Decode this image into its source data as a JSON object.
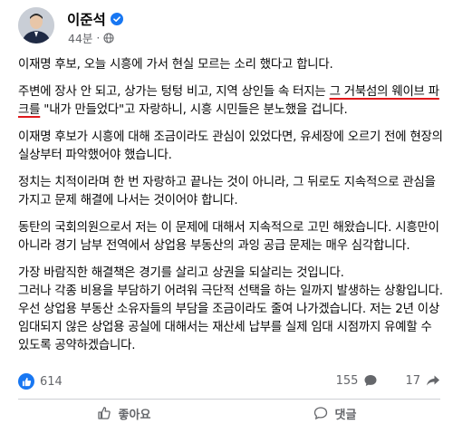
{
  "post": {
    "author": "이준석",
    "time": "44분",
    "dot": "·",
    "paragraphs": [
      {
        "before": "이재명 후보, 오늘 시흥에 가서 현실 모르는 소리 했다고 합니다.",
        "highlight": "",
        "after": ""
      },
      {
        "before": "주변에 장사 안 되고, 상가는 텅텅 비고, 지역 상인들 속 터지는 ",
        "highlight": "그 거북섬의 웨이브 파크를",
        "after": " \"내가 만들었다\"고 자랑하니, 시흥 시민들은 분노했을 겁니다."
      },
      {
        "before": "이재명 후보가 시흥에 대해 조금이라도 관심이 있었다면, 유세장에 오르기 전에 현장의 실상부터 파악했어야 했습니다.",
        "highlight": "",
        "after": ""
      },
      {
        "before": "정치는 치적이라며 한 번 자랑하고 끝나는 것이 아니라, 그 뒤로도 지속적으로 관심을 가지고 문제 해결에 나서는 것이어야 합니다.",
        "highlight": "",
        "after": ""
      },
      {
        "before": "동탄의 국회의원으로서 저는 이 문제에 대해서 지속적으로 고민 해왔습니다. 시흥만이 아니라 경기 남부 전역에서 상업용 부동산의 과잉 공급 문제는 매우 심각합니다.",
        "highlight": "",
        "after": ""
      },
      {
        "before": "가장 바람직한 해결책은 경기를 살리고 상권을 되살리는 것입니다.\n그러나 각종 비용을 부담하기 어려워 극단적 선택을 하는 일까지 발생하는 상황입니다. 우선 상업용 부동산 소유자들의 부담을 조금이라도 줄여 나가겠습니다. 저는 2년 이상 임대되지 않은 상업용 공실에 대해서는 재산세 납부를 실제 임대 시점까지 유예할 수 있도록 공약하겠습니다.",
        "highlight": "",
        "after": ""
      }
    ]
  },
  "stats": {
    "likes": "614",
    "comments": "155",
    "shares": "17"
  },
  "actions": {
    "like": "좋아요",
    "comment": "댓글"
  },
  "colors": {
    "accent": "#1877f2",
    "highlight_underline": "#e0191c"
  }
}
